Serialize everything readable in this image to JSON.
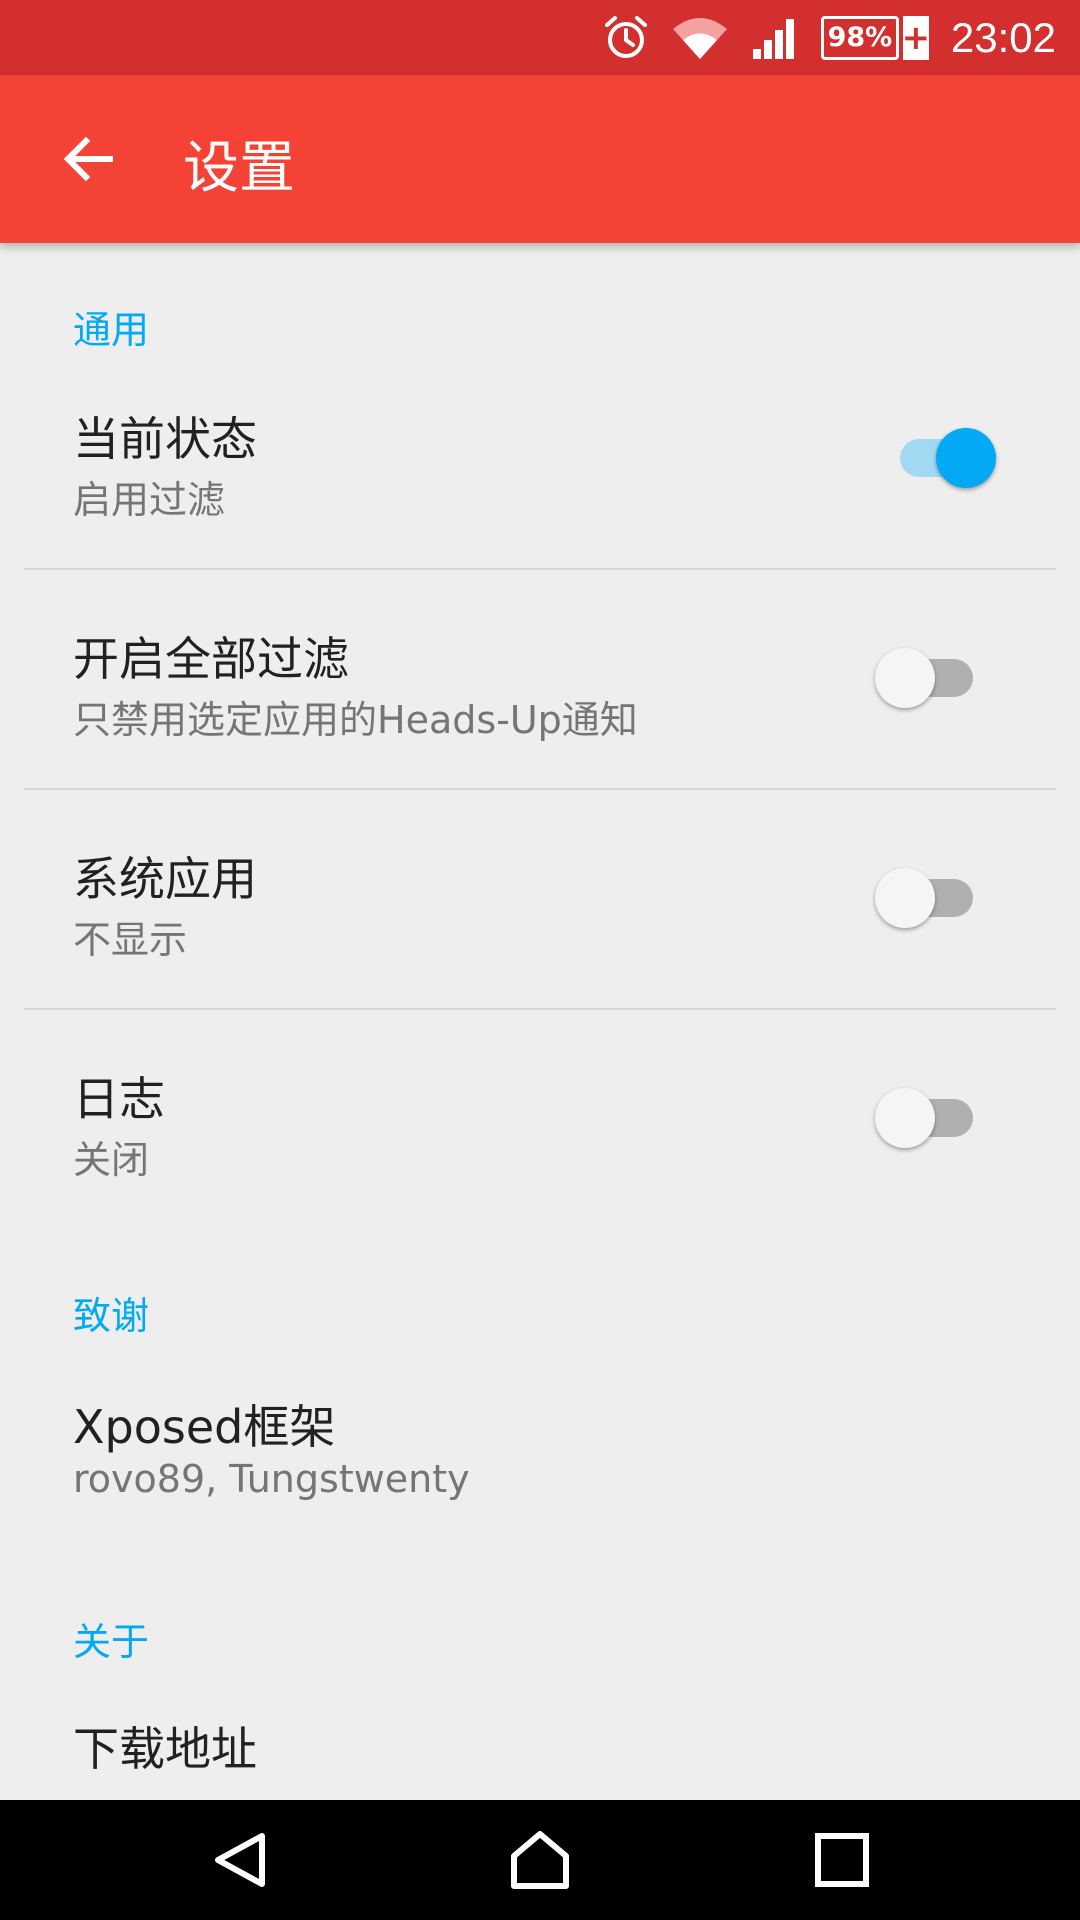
{
  "status_bar": {
    "battery_percent": "98%",
    "battery_charging": "+",
    "time": "23:02"
  },
  "app_bar": {
    "title": "设置"
  },
  "sections": [
    {
      "header": "通用",
      "items": [
        {
          "title": "当前状态",
          "subtitle": "启用过滤",
          "switch_on": true
        },
        {
          "title": "开启全部过滤",
          "subtitle": "只禁用选定应用的Heads-Up通知",
          "switch_on": false
        },
        {
          "title": "系统应用",
          "subtitle": "不显示",
          "switch_on": false
        },
        {
          "title": "日志",
          "subtitle": "关闭",
          "switch_on": false
        }
      ]
    },
    {
      "header": "致谢",
      "items": [
        {
          "title": "Xposed框架",
          "subtitle": "rovo89, Tungstwenty"
        }
      ]
    },
    {
      "header": "关于",
      "items": [
        {
          "title": "下载地址"
        }
      ]
    }
  ],
  "colors": {
    "status_bar": "#d32f2f",
    "app_bar": "#f44336",
    "accent": "#03a9f4"
  }
}
